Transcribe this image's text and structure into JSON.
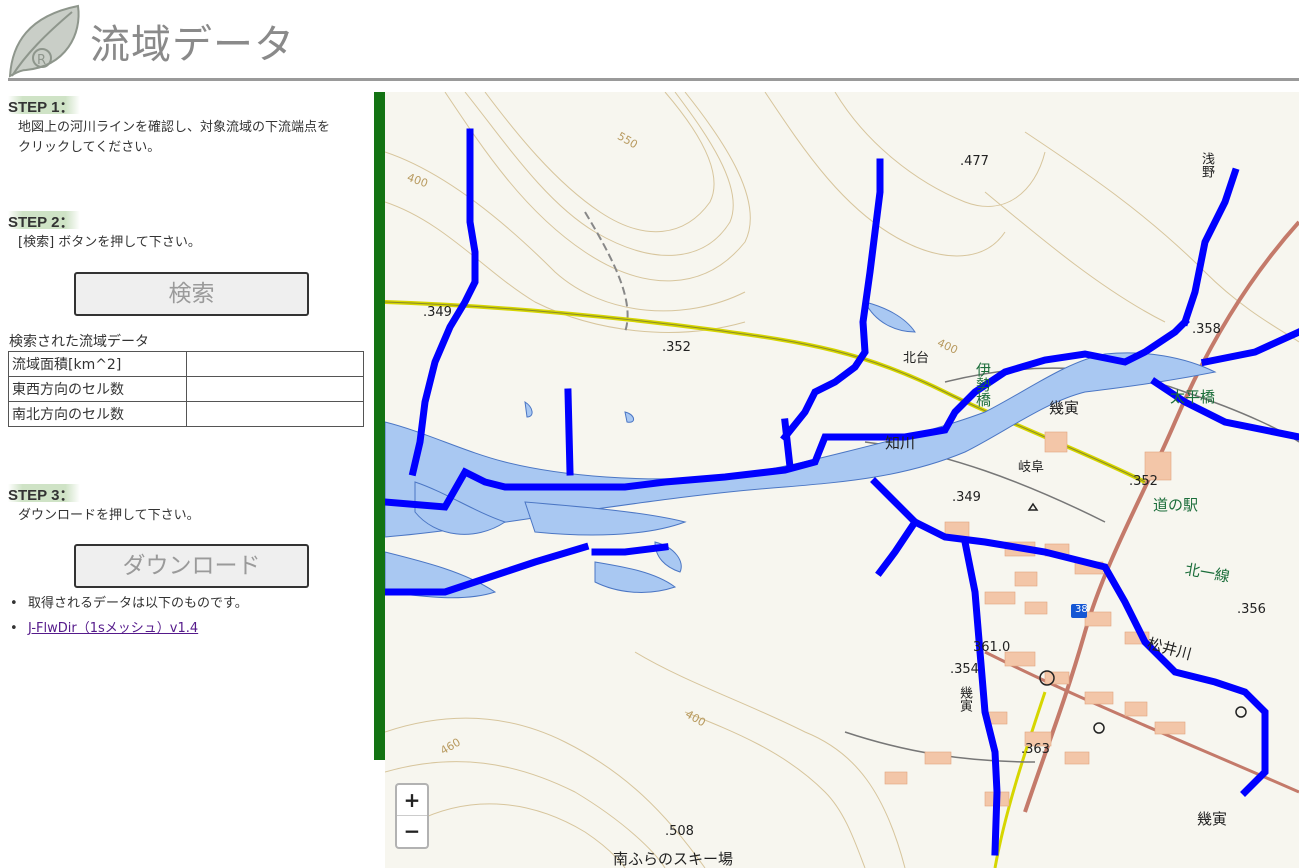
{
  "header": {
    "title": "流域データ",
    "logo_icon": "leaf-logo-icon"
  },
  "step1": {
    "badge": "STEP 1：",
    "text_line1": "地図上の河川ラインを確認し、対象流域の下流端点を",
    "text_line2": "クリックしてください。"
  },
  "step2": {
    "badge": "STEP 2：",
    "text": "[検索] ボタンを押して下さい。",
    "search_button": "検索"
  },
  "result": {
    "caption": "検索された流域データ",
    "rows": [
      {
        "label": "流域面積[km^2]",
        "value": ""
      },
      {
        "label": "東西方向のセル数",
        "value": ""
      },
      {
        "label": "南北方向のセル数",
        "value": ""
      }
    ]
  },
  "step3": {
    "badge": "STEP 3：",
    "text": "ダウンロードを押して下さい。",
    "download_button": "ダウンロード"
  },
  "notes": {
    "item1": "取得されるデータは以下のものです。",
    "item2_link": "J-FlwDir（1sメッシュ）v1.4"
  },
  "map": {
    "labels": {
      "l477": ".477",
      "asano": "浅野",
      "l349a": ".349",
      "l352a": ".352",
      "kitadai": "北台",
      "ise": "伊勢橋",
      "l358": ".358",
      "taiheibashi": "太平橋",
      "ikutora1": "幾寅",
      "chiri": "知川",
      "gifu": "岐阜",
      "l352b": ".352",
      "l349b": ".349",
      "michinoeki": "道の駅",
      "kitaichisen": "北一線",
      "l356": ".356",
      "r38": "38",
      "matsuigawa": "松井川",
      "l3610": "361.0",
      "l354": ".354",
      "ikutora2": "幾寅",
      "l363": ".363",
      "l508": ".508",
      "ikutora3": "幾寅",
      "ski": "南ふらのスキー場",
      "c400a": "400",
      "c550": "550",
      "c400b": "400",
      "c460": "460",
      "c400c": "400"
    },
    "zoom_in": "+",
    "zoom_out": "−"
  },
  "colors": {
    "accent_green": "#137313",
    "river_blue": "#0000ff",
    "water_fill": "#a9c8f2",
    "step_badge": "#cfe3c6"
  }
}
